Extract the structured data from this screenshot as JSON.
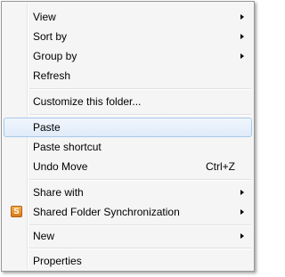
{
  "menu": {
    "view": {
      "label": "View"
    },
    "sort_by": {
      "label": "Sort by"
    },
    "group_by": {
      "label": "Group by"
    },
    "refresh": {
      "label": "Refresh"
    },
    "customize": {
      "label": "Customize this folder..."
    },
    "paste": {
      "label": "Paste",
      "state": "highlighted"
    },
    "paste_shortcut": {
      "label": "Paste shortcut"
    },
    "undo_move": {
      "label": "Undo Move",
      "shortcut": "Ctrl+Z"
    },
    "share_with": {
      "label": "Share with"
    },
    "shared_folder_sync": {
      "label": "Shared Folder Synchronization",
      "icon": "shared-folder-sync-icon",
      "icon_glyph": "S"
    },
    "new": {
      "label": "New"
    },
    "properties": {
      "label": "Properties"
    }
  },
  "colors": {
    "menu_background": "#f5f5f5",
    "border": "#979797",
    "highlight_border": "#a8c9ee",
    "highlight_fill": "#dfebf9",
    "sync_icon": "#e8891f"
  }
}
